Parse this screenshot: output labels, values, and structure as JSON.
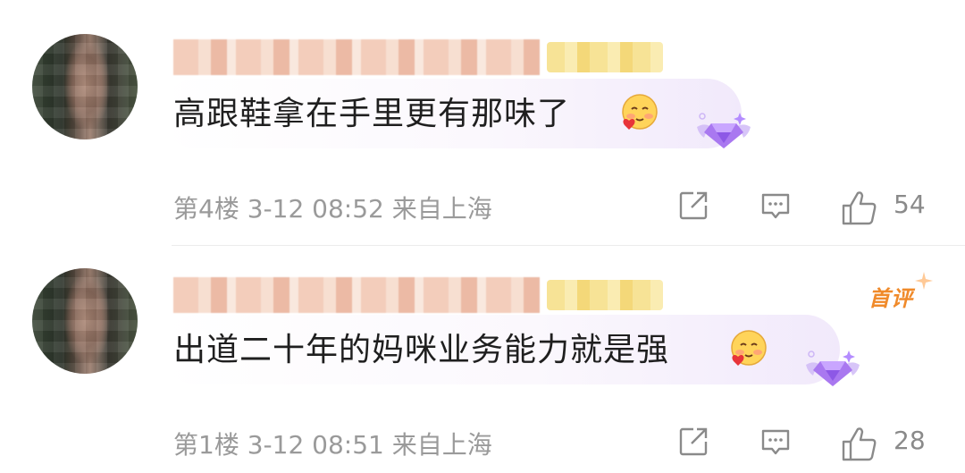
{
  "comments": [
    {
      "text": "高跟鞋拿在手里更有那味了",
      "floor": "第4楼",
      "date": "3-12 08:52",
      "location": "来自上海",
      "likes": "54",
      "badge": ""
    },
    {
      "text": "出道二十年的妈咪业务能力就是强",
      "floor": "第1楼",
      "date": "3-12 08:51",
      "location": "来自上海",
      "likes": "28",
      "badge": "首评"
    }
  ],
  "icons": {
    "share": "share-icon",
    "reply": "comment-icon",
    "like": "thumbs-up-icon",
    "emoji": "blush-heart-emoji",
    "member": "diamond-wings-icon"
  },
  "colors": {
    "text": "#1f1f1f",
    "meta": "#9a9a9a",
    "badge": "#f08a2a",
    "gem": "#a978f0"
  }
}
